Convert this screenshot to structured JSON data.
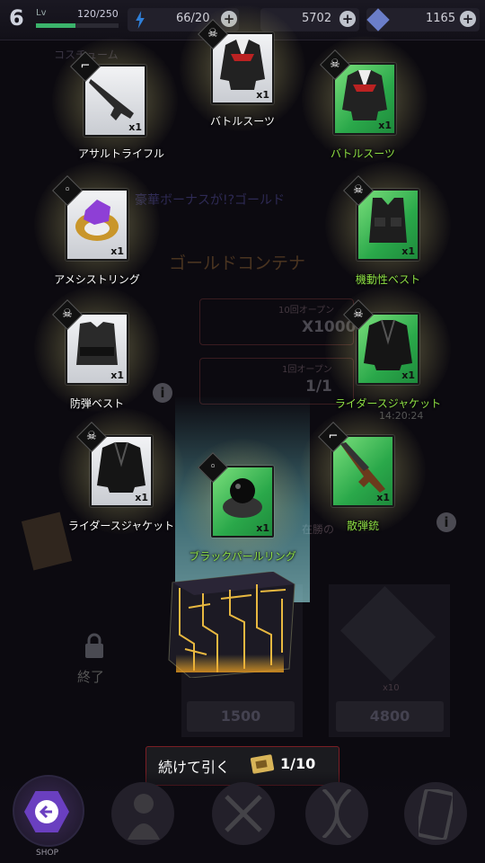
{
  "topbar": {
    "level": "6",
    "level_label": "Lv",
    "xp": "120/250",
    "xp_progress": 0.48,
    "energy": "66/20",
    "coins": "5702",
    "tickets": "1165",
    "plus": "+"
  },
  "background": {
    "section_title": "コスチューム",
    "banner_text": "豪華ボーナスが!?ゴールド",
    "container_title": "ゴールドコンテナ",
    "ten_open_label": "10回オープン",
    "ten_open_price": "X1000",
    "one_open_label": "1回オープン",
    "one_open_price": "1/1",
    "timer": "14:20:24",
    "misc_text": "在勝の",
    "end_label": "終了",
    "price_left": "1500",
    "price_right": "4800",
    "x10": "x10",
    "info": "i"
  },
  "items": [
    {
      "label": "アサルトライフル",
      "qty": "x1",
      "type": "white",
      "badge": "gun-icon",
      "art": "assault-rifle-icon",
      "label_color": "white"
    },
    {
      "label": "バトルスーツ",
      "qty": "x1",
      "type": "white",
      "badge": "skull-icon",
      "art": "battle-suit-icon",
      "label_color": "white"
    },
    {
      "label": "バトルスーツ",
      "qty": "x1",
      "type": "green",
      "badge": "skull-icon",
      "art": "battle-suit-icon",
      "label_color": "green"
    },
    {
      "label": "アメシストリング",
      "qty": "x1",
      "type": "white",
      "badge": "ring-icon",
      "art": "amethyst-ring-icon",
      "label_color": "white"
    },
    {
      "label": "機動性ベスト",
      "qty": "x1",
      "type": "green",
      "badge": "skull-icon",
      "art": "tactical-vest-icon",
      "label_color": "green"
    },
    {
      "label": "防弾ベスト",
      "qty": "x1",
      "type": "white",
      "badge": "skull-icon",
      "art": "bulletproof-vest-icon",
      "label_color": "white"
    },
    {
      "label": "ライダースジャケット",
      "qty": "x1",
      "type": "green",
      "badge": "skull-icon",
      "art": "leather-jacket-icon",
      "label_color": "green"
    },
    {
      "label": "ライダースジャケット",
      "qty": "x1",
      "type": "white",
      "badge": "skull-icon",
      "art": "leather-jacket-icon",
      "label_color": "white"
    },
    {
      "label": "ブラックパールリング",
      "qty": "x1",
      "type": "green",
      "badge": "ring-icon",
      "art": "black-pearl-ring-icon",
      "label_color": "green"
    },
    {
      "label": "散弾銃",
      "qty": "x1",
      "type": "green",
      "badge": "gun-icon",
      "art": "shotgun-icon",
      "label_color": "green"
    }
  ],
  "action": {
    "continue_label": "続けて引く",
    "continue_count": "1/10"
  },
  "nav": {
    "shop_label": "SHOP"
  }
}
